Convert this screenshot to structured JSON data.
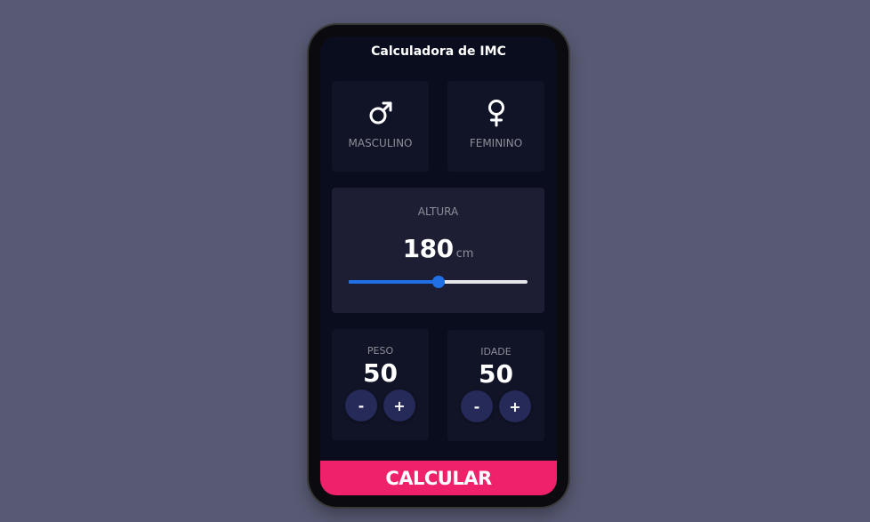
{
  "app": {
    "title": "Calculadora de IMC"
  },
  "gender": {
    "male_label": "MASCULINO",
    "female_label": "FEMININO",
    "male_icon": "male-symbol-icon",
    "female_icon": "female-symbol-icon"
  },
  "height": {
    "label": "ALTURA",
    "value": "180",
    "unit": "cm",
    "slider_fraction": 0.5
  },
  "weight": {
    "label": "PESO",
    "value": "50",
    "minus_label": "-",
    "plus_label": "+"
  },
  "age": {
    "label": "IDADE",
    "value": "50",
    "minus_label": "-",
    "plus_label": "+"
  },
  "calculate_button": {
    "label": "CALCULAR"
  },
  "colors": {
    "background": "#585a74",
    "screen": "#0a0d1d",
    "card": "#111427",
    "active_card": "#1d1e33",
    "accent": "#f0216b",
    "slider": "#1f6fe5",
    "round_button": "#262a59"
  }
}
